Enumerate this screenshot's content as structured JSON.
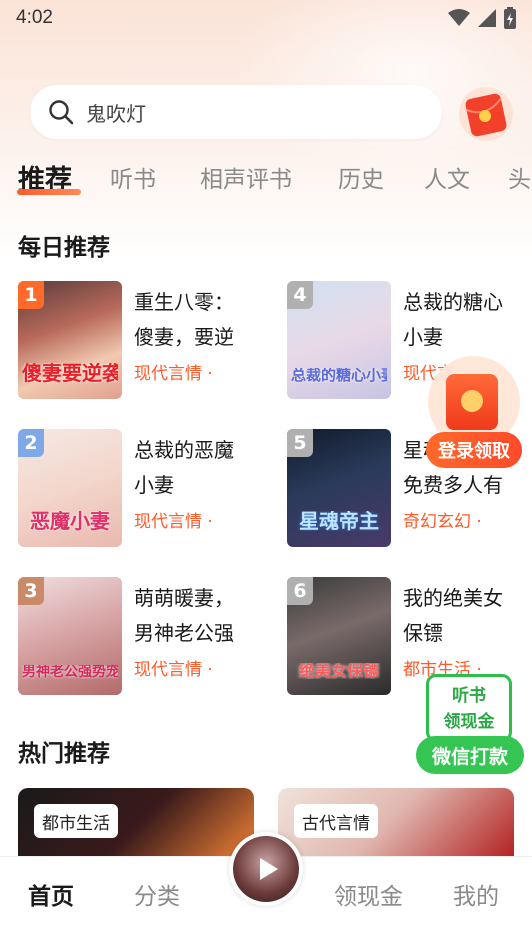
{
  "status_bar": {
    "time": "4:02"
  },
  "search": {
    "text": "鬼吹灯"
  },
  "tabs": [
    {
      "label": "推荐",
      "active": true
    },
    {
      "label": "听书"
    },
    {
      "label": "相声评书"
    },
    {
      "label": "历史"
    },
    {
      "label": "人文"
    },
    {
      "label": "头"
    }
  ],
  "daily": {
    "title": "每日推荐",
    "books": [
      {
        "rank": "1",
        "title_line1": "重生八零：",
        "title_line2": "傻妻，要逆",
        "genre": "现代言情 ·",
        "cover_text": "傻妻要逆袭",
        "rank_color": "#ff6a2a"
      },
      {
        "rank": "2",
        "title_line1": "总裁的恶魔",
        "title_line2": "小妻",
        "genre": "现代言情 ·",
        "cover_text": "恶魔小妻",
        "rank_color": "#7fa8e6"
      },
      {
        "rank": "3",
        "title_line1": "萌萌暖妻，",
        "title_line2": "男神老公强",
        "genre": "现代言情 ·",
        "cover_text": "男神老公强势宠爱",
        "rank_color": "#c98a6a"
      },
      {
        "rank": "4",
        "title_line1": "总裁的糖心",
        "title_line2": "小妻",
        "genre": "现代言",
        "cover_text": "总裁的糖心小妻",
        "rank_color": "#b0b0b0"
      },
      {
        "rank": "5",
        "title_line1": "星魂",
        "title_line2": "免费多人有",
        "genre": "奇幻玄幻 ·",
        "cover_text": "星魂帝主",
        "rank_color": "#b0b0b0"
      },
      {
        "rank": "6",
        "title_line1": "我的绝美女",
        "title_line2": "保镖",
        "genre": "都市生活 ·",
        "cover_text": "绝美女保镖",
        "rank_color": "#b0b0b0"
      }
    ]
  },
  "float_redpack": {
    "label": "登录领取"
  },
  "float_wechat": {
    "line1": "听书",
    "line2": "领现金",
    "button": "微信打款"
  },
  "hot": {
    "title": "热门推荐",
    "cards": [
      {
        "tag": "都市生活"
      },
      {
        "tag": "古代言情"
      }
    ]
  },
  "bottom_nav": [
    {
      "label": "首页",
      "active": true
    },
    {
      "label": "分类"
    },
    {
      "label": "领现金"
    },
    {
      "label": "我的"
    }
  ],
  "colors": {
    "accent": "#ff5a2a",
    "wechat_green": "#34c552"
  }
}
